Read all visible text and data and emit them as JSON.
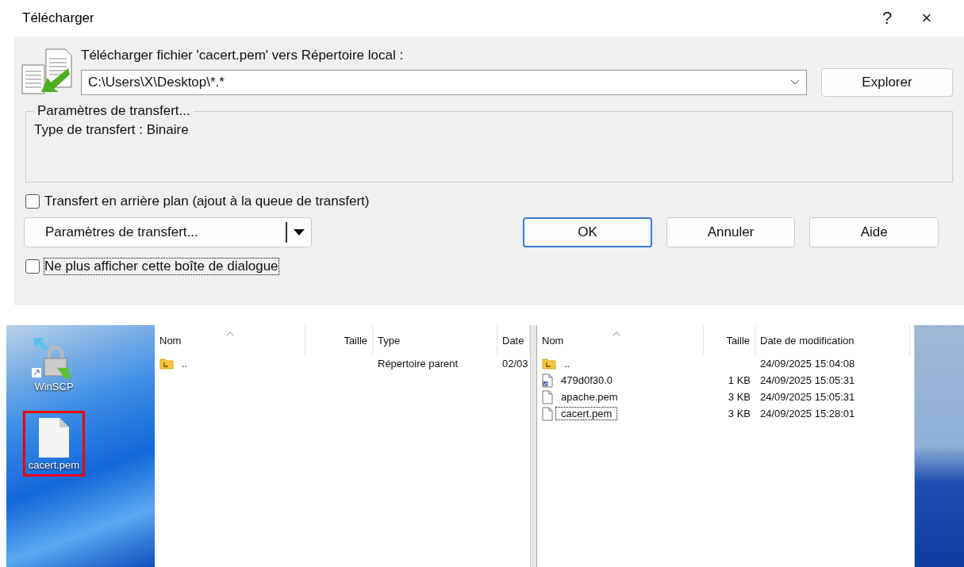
{
  "dialog": {
    "title": "Télécharger",
    "help": "?",
    "close": "×",
    "prompt": "Télécharger fichier 'cacert.pem' vers Répertoire local :",
    "path": "C:\\Users\\X\\Desktop\\*.*",
    "browse_button": "Explorer",
    "group": {
      "title": "Paramètres de transfert...",
      "text": "Type de transfert : Binaire"
    },
    "background_checkbox": {
      "label": "Transfert en arrière plan (ajout à la queue de transfert)",
      "checked": false
    },
    "settings_button": "Paramètres de transfert...",
    "buttons": [
      {
        "label": "OK",
        "default": true
      },
      {
        "label": "Annuler",
        "default": false
      },
      {
        "label": "Aide",
        "default": false
      }
    ],
    "dont_show_checkbox": {
      "label": "Ne plus afficher cette boîte de dialogue",
      "checked": false,
      "focused": true
    }
  },
  "desktop": {
    "icons": [
      {
        "label": "WinSCP",
        "kind": "app",
        "highlighted": false
      },
      {
        "label": "cacert.pem",
        "kind": "file",
        "highlighted": true
      }
    ]
  },
  "local_panel": {
    "columns": [
      "Nom",
      "Taille",
      "Type",
      "Date"
    ],
    "rows": [
      {
        "kind": "parent",
        "name": "..",
        "size": "",
        "type": "Répertoire parent",
        "date": "02/03",
        "focused": false
      }
    ]
  },
  "remote_panel": {
    "columns": [
      "Nom",
      "Taille",
      "Date de modification"
    ],
    "rows": [
      {
        "kind": "parent",
        "name": "..",
        "size": "",
        "date": "24/09/2025 15:04:08",
        "focused": false
      },
      {
        "kind": "link",
        "name": "479d0f30.0",
        "size": "1 KB",
        "date": "24/09/2025 15:05:31",
        "focused": false
      },
      {
        "kind": "file",
        "name": "apache.pem",
        "size": "3 KB",
        "date": "24/09/2025 15:05:31",
        "focused": false
      },
      {
        "kind": "file",
        "name": "cacert.pem",
        "size": "3 KB",
        "date": "24/09/2025 15:28:01",
        "focused": true
      }
    ]
  }
}
